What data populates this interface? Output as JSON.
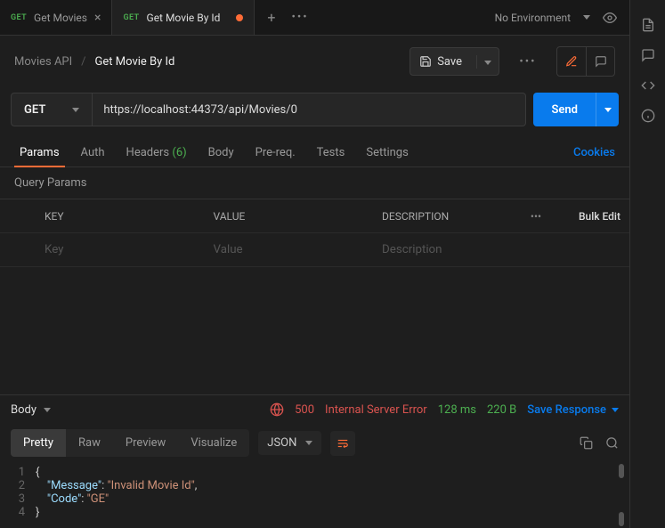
{
  "tabs": [
    {
      "method": "GET",
      "title": "Get Movies",
      "active": false,
      "modified": false
    },
    {
      "method": "GET",
      "title": "Get Movie By Id",
      "active": true,
      "modified": true
    }
  ],
  "environment": {
    "label": "No Environment"
  },
  "breadcrumb": {
    "collection": "Movies API",
    "item": "Get Movie By Id"
  },
  "actions": {
    "save": "Save"
  },
  "request": {
    "method": "GET",
    "url": "https://localhost:44373/api/Movies/0",
    "send": "Send"
  },
  "subtabs": {
    "params": "Params",
    "auth": "Auth",
    "headers": "Headers",
    "headers_count": "(6)",
    "body": "Body",
    "prereq": "Pre-req.",
    "tests": "Tests",
    "settings": "Settings",
    "cookies": "Cookies"
  },
  "query_params": {
    "title": "Query Params",
    "headers": {
      "key": "KEY",
      "value": "VALUE",
      "description": "DESCRIPTION",
      "bulk": "Bulk Edit"
    },
    "placeholders": {
      "key": "Key",
      "value": "Value",
      "description": "Description"
    }
  },
  "response": {
    "section": "Body",
    "status_code": "500",
    "status_text": "Internal Server Error",
    "time": "128 ms",
    "size": "220 B",
    "save": "Save Response"
  },
  "viewtabs": {
    "pretty": "Pretty",
    "raw": "Raw",
    "preview": "Preview",
    "visualize": "Visualize",
    "format": "JSON"
  },
  "code": {
    "l1": "{",
    "l2_indent": "    ",
    "l2_key": "\"Message\"",
    "l2_colon": ": ",
    "l2_val": "\"Invalid Movie Id\"",
    "l2_comma": ",",
    "l3_indent": "    ",
    "l3_key": "\"Code\"",
    "l3_colon": ": ",
    "l3_val": "\"GE\"",
    "l4": "}"
  }
}
